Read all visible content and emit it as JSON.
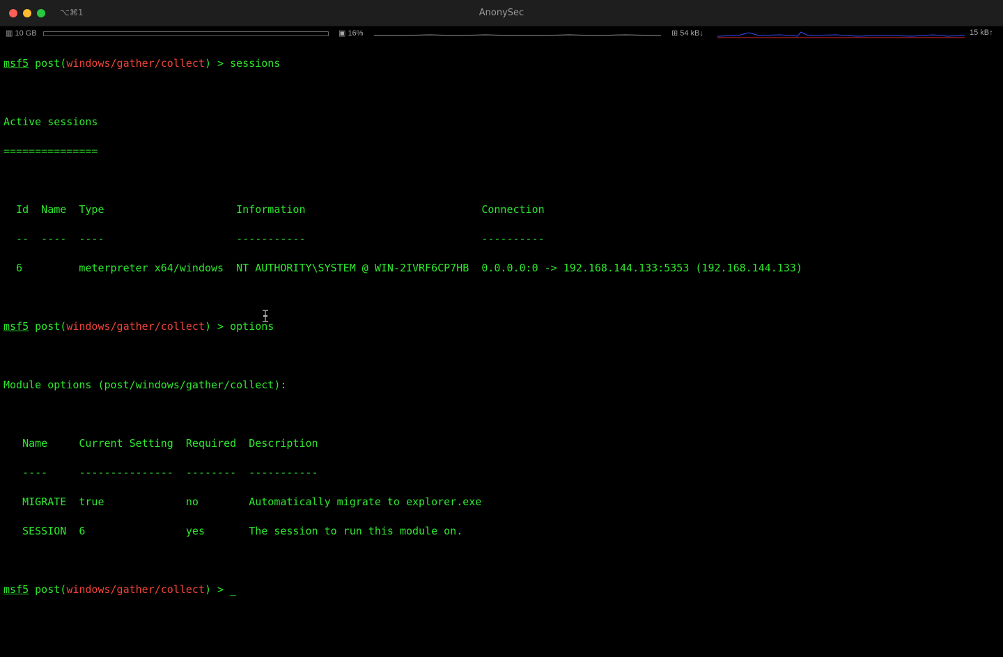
{
  "window": {
    "title": "AnonySec",
    "shortcut": "⌥⌘1"
  },
  "status": {
    "memory": "10 GB",
    "cpu": "16%",
    "net_down": "54 kB↓",
    "net_up": "15 kB↑"
  },
  "colors": {
    "green": "#2ee82e",
    "red": "#f0443a",
    "background": "#000000"
  },
  "terminal": {
    "prompt": {
      "msf": "msf5",
      "post": " post(",
      "module": "windows/gather/collect",
      "close": ") > "
    },
    "cmd1": "sessions",
    "active_title": "Active sessions",
    "active_rule": "===============",
    "sessions_header": "  Id  Name  Type                     Information                            Connection",
    "sessions_dash": "  --  ----  ----                     -----------                            ----------",
    "sessions_row": "  6         meterpreter x64/windows  NT AUTHORITY\\SYSTEM @ WIN-2IVRF6CP7HB  0.0.0.0:0 -> 192.168.144.133:5353 (192.168.144.133)",
    "cmd2": "options",
    "module_options_title": "Module options (post/windows/gather/collect):",
    "options_header": "   Name     Current Setting  Required  Description",
    "options_dash": "   ----     ---------------  --------  -----------",
    "options_rows": [
      "   MIGRATE  true             no        Automatically migrate to explorer.exe",
      "   SESSION  6                yes       The session to run this module on."
    ],
    "cursor": "_"
  }
}
